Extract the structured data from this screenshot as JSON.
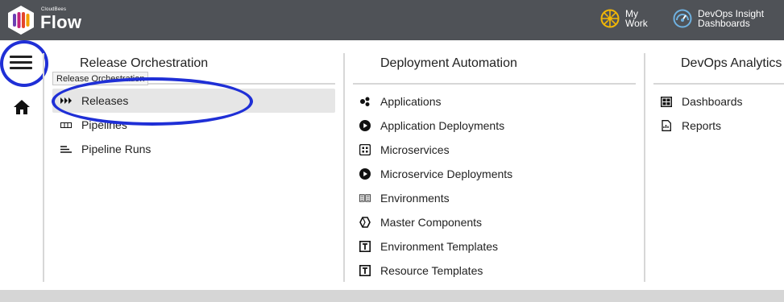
{
  "header": {
    "brand_small": "CloudBees",
    "brand_name": "Flow",
    "my_work_line1": "My",
    "my_work_line2": "Work",
    "devops_line1": "DevOps Insight",
    "devops_line2": "Dashboards"
  },
  "tooltip": "Release Orchestration",
  "columns": {
    "release": {
      "title": "Release Orchestration",
      "items": [
        {
          "label": "Releases",
          "icon": "releases-icon"
        },
        {
          "label": "Pipelines",
          "icon": "pipelines-icon"
        },
        {
          "label": "Pipeline Runs",
          "icon": "pipeline-runs-icon"
        }
      ]
    },
    "deploy": {
      "title": "Deployment Automation",
      "items": [
        {
          "label": "Applications",
          "icon": "applications-icon"
        },
        {
          "label": "Application Deployments",
          "icon": "play-icon"
        },
        {
          "label": "Microservices",
          "icon": "microservices-icon"
        },
        {
          "label": "Microservice Deployments",
          "icon": "play-icon"
        },
        {
          "label": "Environments",
          "icon": "environments-icon"
        },
        {
          "label": "Master Components",
          "icon": "master-components-icon"
        },
        {
          "label": "Environment Templates",
          "icon": "template-icon"
        },
        {
          "label": "Resource Templates",
          "icon": "template-icon"
        }
      ]
    },
    "analytics": {
      "title": "DevOps Analytics",
      "items": [
        {
          "label": "Dashboards",
          "icon": "dashboards-icon"
        },
        {
          "label": "Reports",
          "icon": "reports-icon"
        }
      ]
    }
  },
  "colors": {
    "header_bg": "#4f5257",
    "annotation": "#1f2fd6",
    "active_bg": "#e6e6e6",
    "mywork_icon": "#f2b705",
    "devops_icon": "#6fb1e0"
  }
}
